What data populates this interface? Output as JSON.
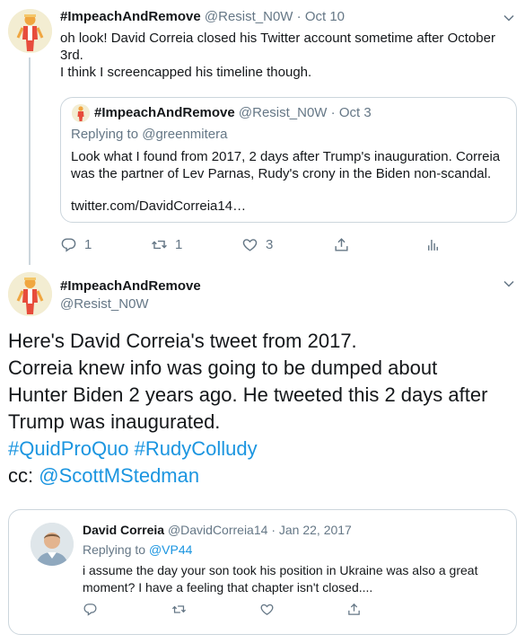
{
  "tweet1": {
    "name": "#ImpeachAndRemove",
    "handle": "@Resist_N0W",
    "sep": "·",
    "date": "Oct 10",
    "body_lines": [
      "oh look! David Correia closed his Twitter account sometime after October",
      "3rd.",
      "I think I screencapped his timeline though."
    ],
    "quote": {
      "name": "#ImpeachAndRemove",
      "handle": "@Resist_N0W",
      "sep": "·",
      "date": "Oct 3",
      "replying_to": "Replying to @greenmitera",
      "body_lines": [
        "Look what I found from 2017, 2 days after Trump's inauguration. Correia",
        "was the partner of Lev Parnas, Rudy's crony in the Biden non-scandal."
      ],
      "link": "twitter.com/DavidCorreia14…"
    },
    "actions": {
      "replies": "1",
      "retweets": "1",
      "likes": "3"
    }
  },
  "tweet2": {
    "name": "#ImpeachAndRemove",
    "handle": "@Resist_N0W",
    "body_lines": [
      "Here's David Correia's tweet from 2017.",
      "Correia knew info was going to be dumped about",
      "Hunter Biden 2 years ago. He tweeted this 2 days after",
      "Trump was inaugurated."
    ],
    "hashtags": [
      "#QuidProQuo",
      "#RudyColludy"
    ],
    "cc_label": "cc:",
    "mention": "@ScottMStedman",
    "quote": {
      "name": "David Correia",
      "handle": "@DavidCorreia14",
      "sep": "·",
      "date": "Jan 22, 2017",
      "replying_prefix": "Replying to",
      "replying_handle": "@VP44",
      "body_lines": [
        "i assume the day your son took his position in Ukraine was also a great",
        "moment? I have a feeling that chapter isn't closed...."
      ]
    }
  },
  "icons": {
    "reply": "reply-icon",
    "retweet": "retweet-icon",
    "like": "heart-icon",
    "share": "share-icon",
    "analytics": "analytics-icon",
    "more": "chevron-down-icon"
  },
  "colors": {
    "link": "#1b95e0",
    "secondary_text": "#657786",
    "border": "#ccd6dd",
    "primary_text": "#14171a"
  }
}
